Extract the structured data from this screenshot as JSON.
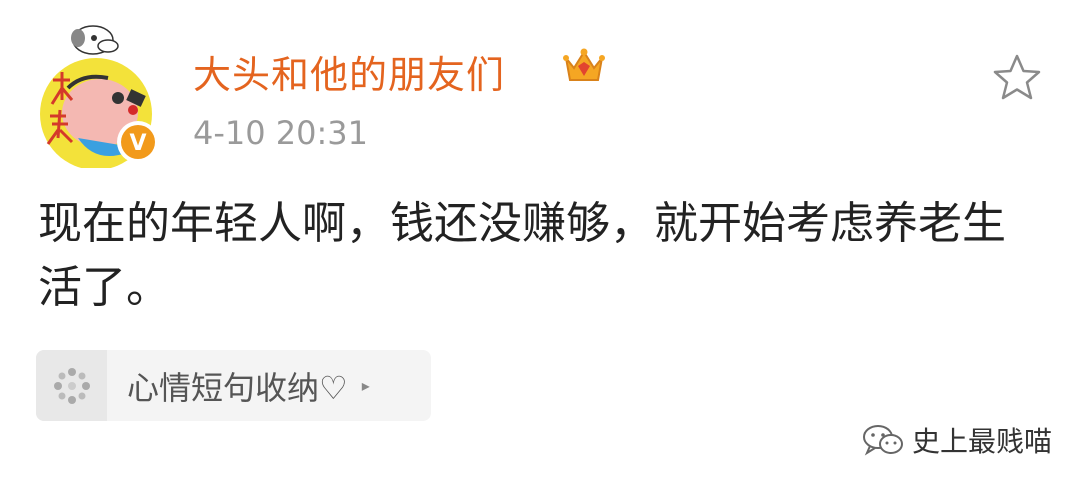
{
  "post": {
    "username": "大头和他的朋友们",
    "timestamp": "4-10 20:31",
    "text": "现在的年轻人啊，钱还没赚够，就开始考虑养老生活了。",
    "avatar_text": "大头"
  },
  "topic": {
    "label": "心情短句收纳♡",
    "arrow": "▸"
  },
  "watermark": {
    "label": "史上最贱喵"
  },
  "colors": {
    "username": "#e4641f",
    "timestamp": "#9a9a9a",
    "text": "#222222",
    "verified_badge": "#f29a1b"
  },
  "icons": {
    "crown": "crown-icon",
    "verified": "verified-v-icon",
    "favorite": "star-outline-icon",
    "topic": "sparkle-dots-icon",
    "watermark": "wechat-chat-icon"
  }
}
